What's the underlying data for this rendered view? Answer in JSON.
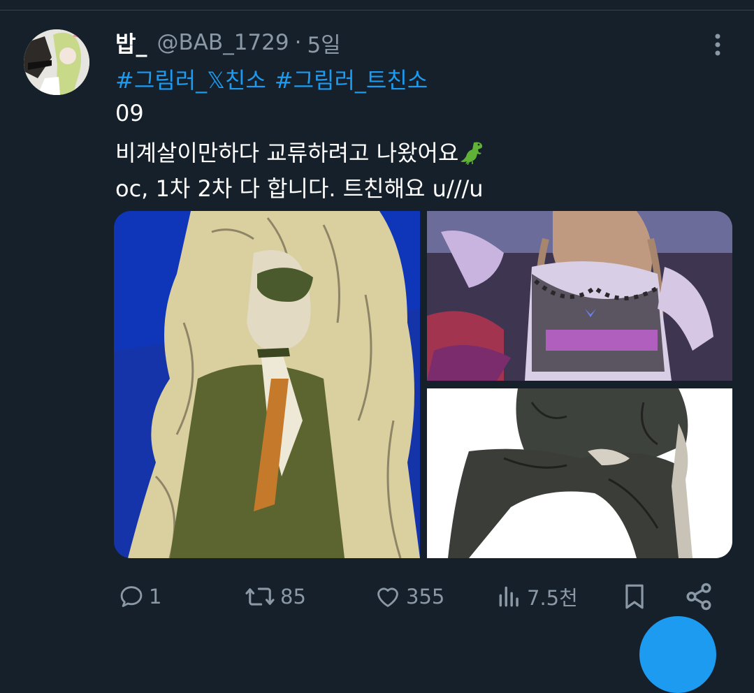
{
  "tweet": {
    "author_name": "밥_",
    "author_handle": "@BAB_1729",
    "separator": "·",
    "time_ago": "5일",
    "hashtags": [
      "#그림러_𝕏친소",
      "#그림러_트친소"
    ],
    "lines": [
      "09",
      "비계살이만하다 교류하려고 나왔어요",
      "oc, 1차 2차 다 합니다. 트친해요 u///u"
    ],
    "emoji_icon": "t-rex-icon"
  },
  "actions": {
    "reply_count": "1",
    "retweet_count": "85",
    "like_count": "355",
    "view_count": "7.5천"
  },
  "colors": {
    "background": "#15202b",
    "accent": "#1d9bf0",
    "muted": "#8b98a5",
    "text": "#ffffff"
  }
}
